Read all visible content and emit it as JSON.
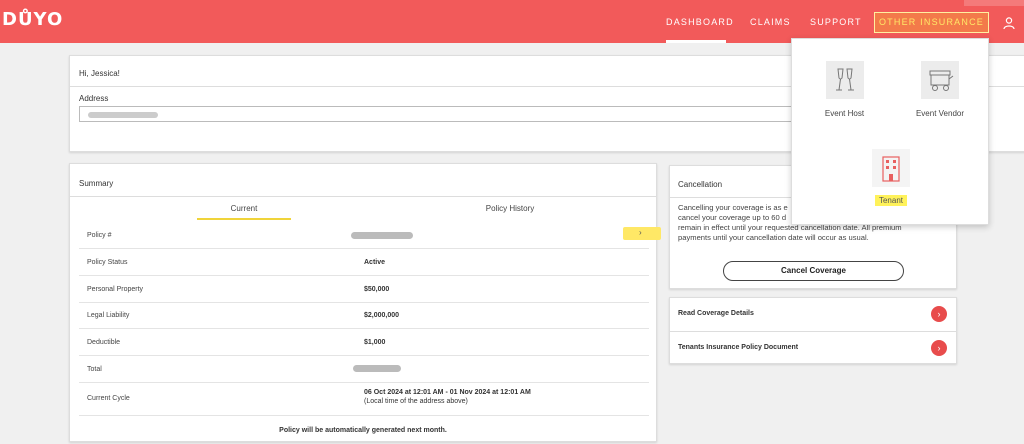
{
  "navbar": {
    "logo": "DŮYO",
    "items": [
      "DASHBOARD",
      "CLAIMS",
      "SUPPORT"
    ],
    "other_insurance": "OTHER INSURANCE",
    "brand_color": "#f25a5a"
  },
  "greeting": {
    "hi": "Hi, Jessica!",
    "address_label": "Address"
  },
  "summary": {
    "title": "Summary",
    "tabs": [
      "Current",
      "Policy History"
    ],
    "rows": [
      {
        "label": "Policy #",
        "value": ""
      },
      {
        "label": "Policy Status",
        "value": "Active"
      },
      {
        "label": "Personal Property",
        "value": "$50,000"
      },
      {
        "label": "Legal Liability",
        "value": "$2,000,000"
      },
      {
        "label": "Deductible",
        "value": "$1,000"
      },
      {
        "label": "Total",
        "value": ""
      },
      {
        "label": "Current Cycle",
        "value": "06 Oct 2024 at 12:01 AM - 01 Nov 2024 at 12:01 AM",
        "sub": "(Local time of the address above)"
      }
    ],
    "footer": "Policy will be automatically generated next month."
  },
  "cancellation": {
    "title": "Cancellation",
    "body_lines": [
      "Cancelling your coverage is as e",
      "cancel your coverage up to 60 d",
      "remain in effect until your requested cancellation date. All premium",
      "payments until your cancellation date will occur as usual."
    ],
    "button": "Cancel Coverage"
  },
  "documents": {
    "items": [
      "Read Coverage Details",
      "Tenants Insurance Policy Document"
    ]
  },
  "dropdown": {
    "items": [
      "Event Host",
      "Event Vendor",
      "Tenant"
    ]
  }
}
